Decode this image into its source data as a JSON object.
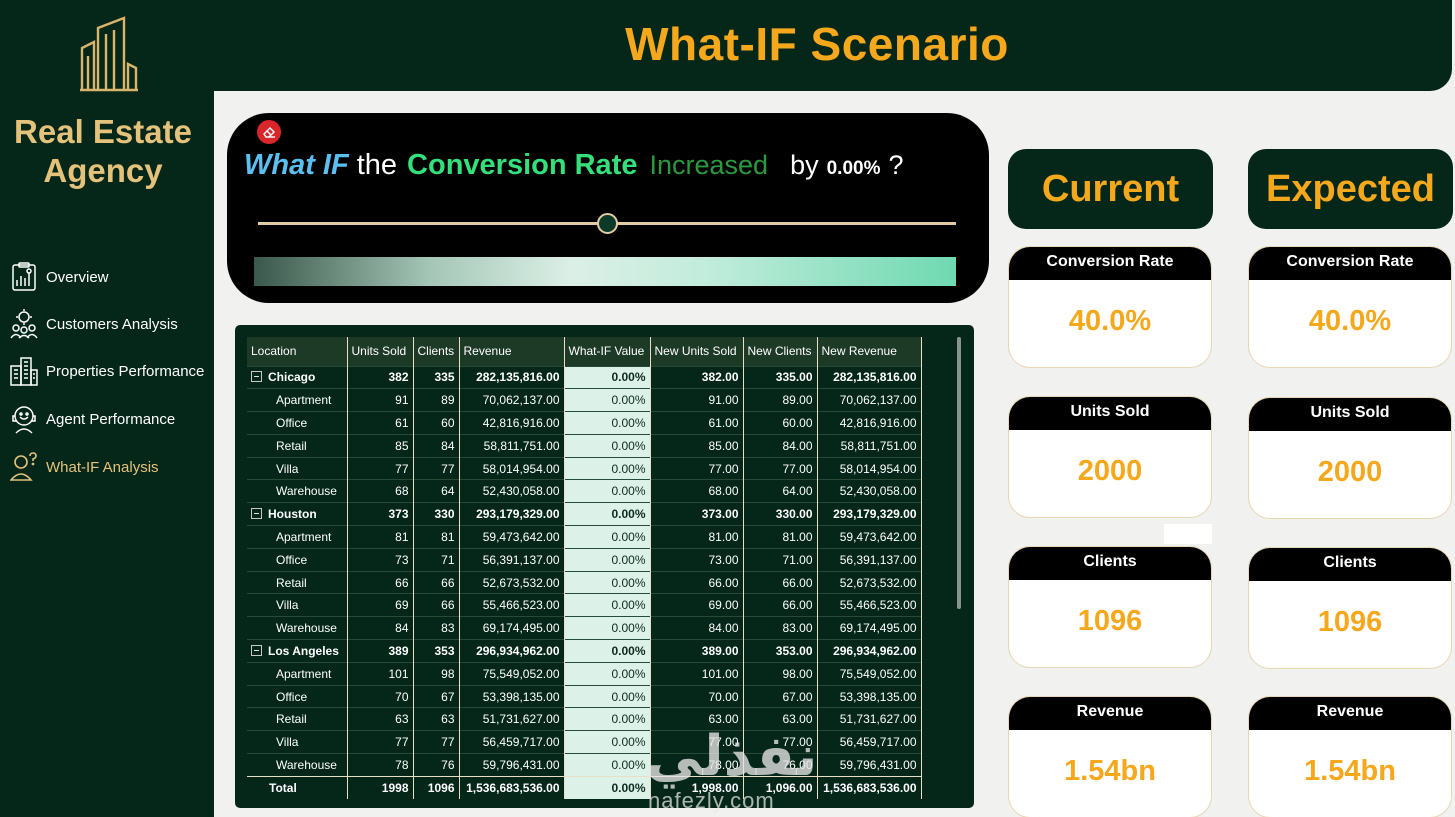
{
  "header": {
    "title": "What-IF Scenario"
  },
  "brand": {
    "line1": "Real Estate",
    "line2": "Agency"
  },
  "nav": [
    {
      "label": "Overview",
      "icon": "chart-report-icon",
      "active": false
    },
    {
      "label": "Customers Analysis",
      "icon": "customers-gear-icon",
      "active": false
    },
    {
      "label": "Properties Performance",
      "icon": "buildings-icon",
      "active": false
    },
    {
      "label": "Agent Performance",
      "icon": "agent-icon",
      "active": false
    },
    {
      "label": "What-IF Analysis",
      "icon": "user-question-icon",
      "active": true
    }
  ],
  "whatif": {
    "q_what": "What IF",
    "q_the": "the",
    "q_rate": "Conversion Rate",
    "q_increased": "Increased",
    "q_by": "by",
    "q_value": "0.00%",
    "q_mark": "?",
    "slider_fraction": 0.5
  },
  "table": {
    "columns": [
      "Location",
      "Units Sold",
      "Clients",
      "Revenue",
      "What-IF Value",
      "New Units Sold",
      "New Clients",
      "New Revenue"
    ],
    "rows": [
      {
        "type": "city",
        "cells": [
          "Chicago",
          "382",
          "335",
          "282,135,816.00",
          "0.00%",
          "382.00",
          "335.00",
          "282,135,816.00"
        ]
      },
      {
        "type": "sub",
        "cells": [
          "Apartment",
          "91",
          "89",
          "70,062,137.00",
          "0.00%",
          "91.00",
          "89.00",
          "70,062,137.00"
        ]
      },
      {
        "type": "sub",
        "cells": [
          "Office",
          "61",
          "60",
          "42,816,916.00",
          "0.00%",
          "61.00",
          "60.00",
          "42,816,916.00"
        ]
      },
      {
        "type": "sub",
        "cells": [
          "Retail",
          "85",
          "84",
          "58,811,751.00",
          "0.00%",
          "85.00",
          "84.00",
          "58,811,751.00"
        ]
      },
      {
        "type": "sub",
        "cells": [
          "Villa",
          "77",
          "77",
          "58,014,954.00",
          "0.00%",
          "77.00",
          "77.00",
          "58,014,954.00"
        ]
      },
      {
        "type": "sub",
        "cells": [
          "Warehouse",
          "68",
          "64",
          "52,430,058.00",
          "0.00%",
          "68.00",
          "64.00",
          "52,430,058.00"
        ]
      },
      {
        "type": "city",
        "cells": [
          "Houston",
          "373",
          "330",
          "293,179,329.00",
          "0.00%",
          "373.00",
          "330.00",
          "293,179,329.00"
        ]
      },
      {
        "type": "sub",
        "cells": [
          "Apartment",
          "81",
          "81",
          "59,473,642.00",
          "0.00%",
          "81.00",
          "81.00",
          "59,473,642.00"
        ]
      },
      {
        "type": "sub",
        "cells": [
          "Office",
          "73",
          "71",
          "56,391,137.00",
          "0.00%",
          "73.00",
          "71.00",
          "56,391,137.00"
        ]
      },
      {
        "type": "sub",
        "cells": [
          "Retail",
          "66",
          "66",
          "52,673,532.00",
          "0.00%",
          "66.00",
          "66.00",
          "52,673,532.00"
        ]
      },
      {
        "type": "sub",
        "cells": [
          "Villa",
          "69",
          "66",
          "55,466,523.00",
          "0.00%",
          "69.00",
          "66.00",
          "55,466,523.00"
        ]
      },
      {
        "type": "sub",
        "cells": [
          "Warehouse",
          "84",
          "83",
          "69,174,495.00",
          "0.00%",
          "84.00",
          "83.00",
          "69,174,495.00"
        ]
      },
      {
        "type": "city",
        "cells": [
          "Los Angeles",
          "389",
          "353",
          "296,934,962.00",
          "0.00%",
          "389.00",
          "353.00",
          "296,934,962.00"
        ]
      },
      {
        "type": "sub",
        "cells": [
          "Apartment",
          "101",
          "98",
          "75,549,052.00",
          "0.00%",
          "101.00",
          "98.00",
          "75,549,052.00"
        ]
      },
      {
        "type": "sub",
        "cells": [
          "Office",
          "70",
          "67",
          "53,398,135.00",
          "0.00%",
          "70.00",
          "67.00",
          "53,398,135.00"
        ]
      },
      {
        "type": "sub",
        "cells": [
          "Retail",
          "63",
          "63",
          "51,731,627.00",
          "0.00%",
          "63.00",
          "63.00",
          "51,731,627.00"
        ]
      },
      {
        "type": "sub",
        "cells": [
          "Villa",
          "77",
          "77",
          "56,459,717.00",
          "0.00%",
          "77.00",
          "77.00",
          "56,459,717.00"
        ]
      },
      {
        "type": "sub",
        "cells": [
          "Warehouse",
          "78",
          "76",
          "59,796,431.00",
          "0.00%",
          "78.00",
          "76.00",
          "59,796,431.00"
        ]
      }
    ],
    "total": [
      "Total",
      "1998",
      "1096",
      "1,536,683,536.00",
      "0.00%",
      "1,998.00",
      "1,096.00",
      "1,536,683,536.00"
    ]
  },
  "cards": {
    "current_label": "Current",
    "expected_label": "Expected",
    "current": [
      {
        "title": "Conversion Rate",
        "value": "40.0%"
      },
      {
        "title": "Units Sold",
        "value": "2000"
      },
      {
        "title": "Clients",
        "value": "1096"
      },
      {
        "title": "Revenue",
        "value": "1.54bn"
      }
    ],
    "expected": [
      {
        "title": "Conversion Rate",
        "value": "40.0%"
      },
      {
        "title": "Units Sold",
        "value": "2000"
      },
      {
        "title": "Clients",
        "value": "1096"
      },
      {
        "title": "Revenue",
        "value": "1.54bn"
      }
    ]
  },
  "watermark": {
    "arabic": "نفذلي",
    "latin": "nafezly.com"
  },
  "colors": {
    "dark_green": "#05271a",
    "gold": "#e5c27b",
    "orange": "#f5a81c"
  }
}
